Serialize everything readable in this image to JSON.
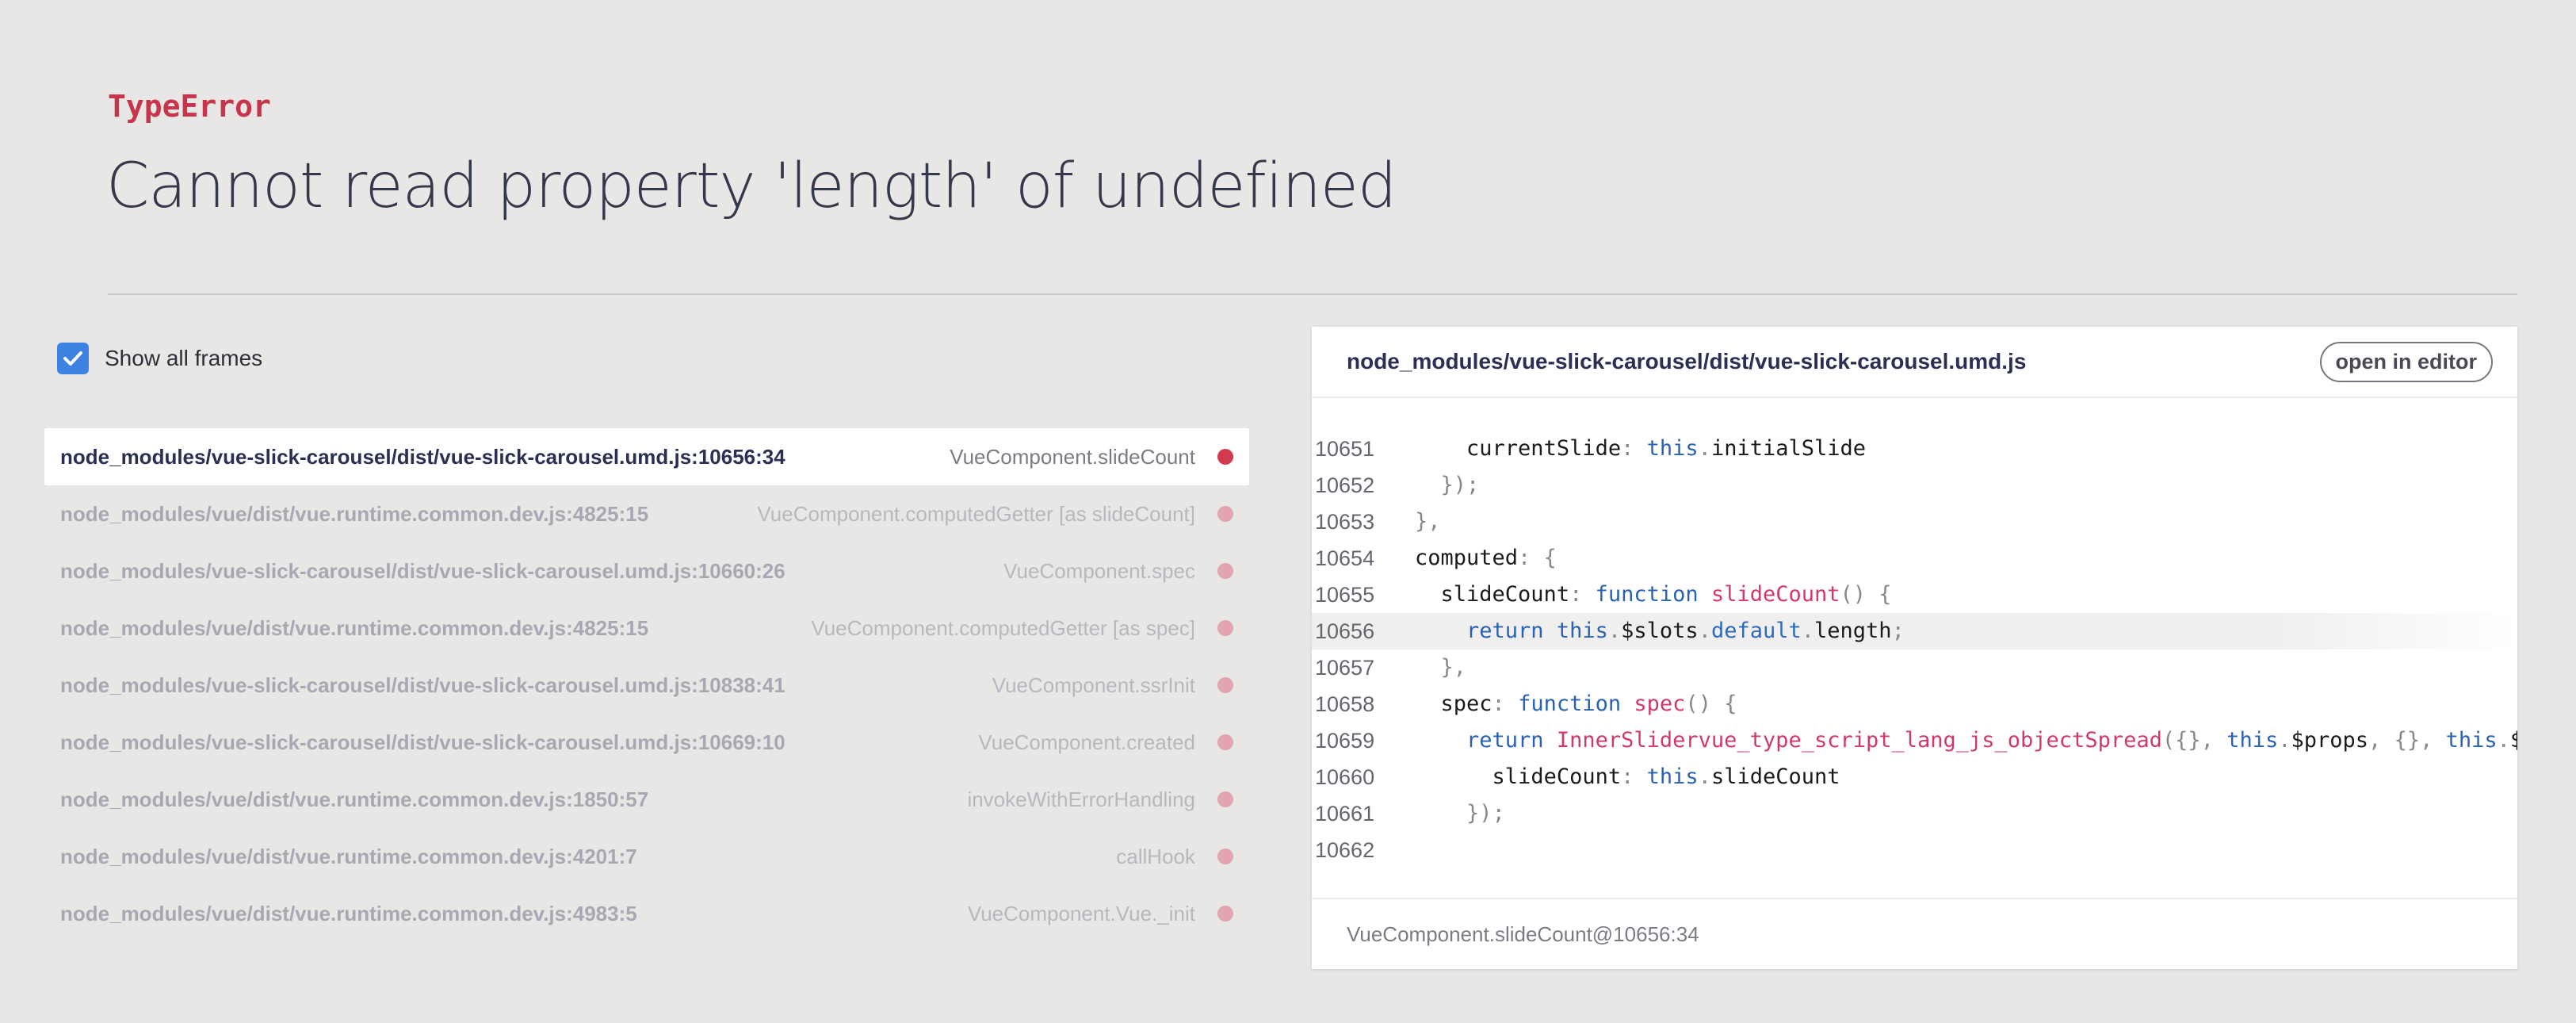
{
  "error": {
    "type": "TypeError",
    "message": "Cannot read property 'length' of undefined"
  },
  "show_all_frames": {
    "label": "Show all frames",
    "checked": true
  },
  "frames": [
    {
      "file": "node_modules/vue-slick-carousel/dist/vue-slick-carousel.umd.js:10656:34",
      "method": "VueComponent.slideCount",
      "selected": true
    },
    {
      "file": "node_modules/vue/dist/vue.runtime.common.dev.js:4825:15",
      "method": "VueComponent.computedGetter [as slideCount]"
    },
    {
      "file": "node_modules/vue-slick-carousel/dist/vue-slick-carousel.umd.js:10660:26",
      "method": "VueComponent.spec"
    },
    {
      "file": "node_modules/vue/dist/vue.runtime.common.dev.js:4825:15",
      "method": "VueComponent.computedGetter [as spec]"
    },
    {
      "file": "node_modules/vue-slick-carousel/dist/vue-slick-carousel.umd.js:10838:41",
      "method": "VueComponent.ssrInit"
    },
    {
      "file": "node_modules/vue-slick-carousel/dist/vue-slick-carousel.umd.js:10669:10",
      "method": "VueComponent.created"
    },
    {
      "file": "node_modules/vue/dist/vue.runtime.common.dev.js:1850:57",
      "method": "invokeWithErrorHandling"
    },
    {
      "file": "node_modules/vue/dist/vue.runtime.common.dev.js:4201:7",
      "method": "callHook"
    },
    {
      "file": "node_modules/vue/dist/vue.runtime.common.dev.js:4983:5",
      "method": "VueComponent.Vue._init"
    }
  ],
  "code_panel": {
    "file": "node_modules/vue-slick-carousel/dist/vue-slick-carousel.umd.js",
    "open_in_editor_label": "open in editor",
    "highlight_line": "10656",
    "lines": [
      {
        "n": "10651",
        "code": "    currentSlide: this.initialSlide"
      },
      {
        "n": "10652",
        "code": "  });"
      },
      {
        "n": "10653",
        "code": "},"
      },
      {
        "n": "10654",
        "code": "computed: {"
      },
      {
        "n": "10655",
        "code": "  slideCount: function slideCount() {"
      },
      {
        "n": "10656",
        "code": "    return this.$slots.default.length;"
      },
      {
        "n": "10657",
        "code": "  },"
      },
      {
        "n": "10658",
        "code": "  spec: function spec() {"
      },
      {
        "n": "10659",
        "code": "    return InnerSlidervue_type_script_lang_js_objectSpread({}, this.$props, {}, this.$dat"
      },
      {
        "n": "10660",
        "code": "      slideCount: this.slideCount"
      },
      {
        "n": "10661",
        "code": "    });"
      },
      {
        "n": "10662",
        "code": ""
      }
    ],
    "footer": "VueComponent.slideCount@10656:34"
  },
  "colors": {
    "accent": "#c7344b",
    "checkbox": "#3d82e0",
    "background": "#e8e7e5"
  },
  "icons": {
    "checkbox": "checkmark-icon"
  }
}
